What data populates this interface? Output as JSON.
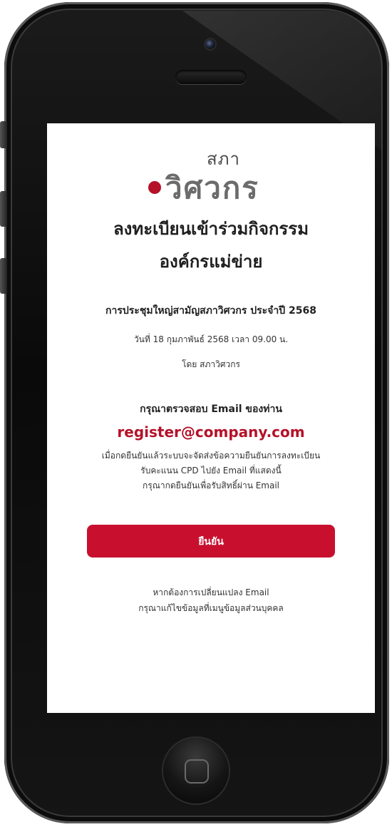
{
  "logo": {
    "top_text": "สภา",
    "main_text": "วิศวกร",
    "accent_color": "#b5122a"
  },
  "header": {
    "title_line1": "ลงทะเบียนเข้าร่วมกิจกรรม",
    "title_line2": "องค์กรแม่ข่าย"
  },
  "event": {
    "name": "การประชุมใหญ่สามัญสภาวิศวกร ประจำปี 2568",
    "datetime": "วันที่ 18 กุมภาพันธ์ 2568 เวลา 09.00 น.",
    "organizer": "โดย สภาวิศวกร"
  },
  "verification": {
    "prompt": "กรุณาตรวจสอบ Email ของท่าน",
    "email": "register@company.com",
    "description": [
      "เมื่อกดยืนยันแล้วระบบจะจัดส่งข้อความยืนยันการลงทะเบียน",
      "รับคะแนน CPD ไปยัง Email ที่แสดงนี้",
      "กรุณากดยืนยันเพื่อรับสิทธิ์ผ่าน Email"
    ]
  },
  "actions": {
    "confirm_label": "ยืนยัน",
    "confirm_color": "#c8102e"
  },
  "footer": {
    "line1": "หากต้องการเปลี่ยนแปลง Email",
    "line2": "กรุณาแก้ไขข้อมูลที่เมนูข้อมูลส่วนบุคคล"
  },
  "device": {
    "icons": [
      "camera-icon",
      "speaker-icon",
      "home-button-icon"
    ]
  }
}
